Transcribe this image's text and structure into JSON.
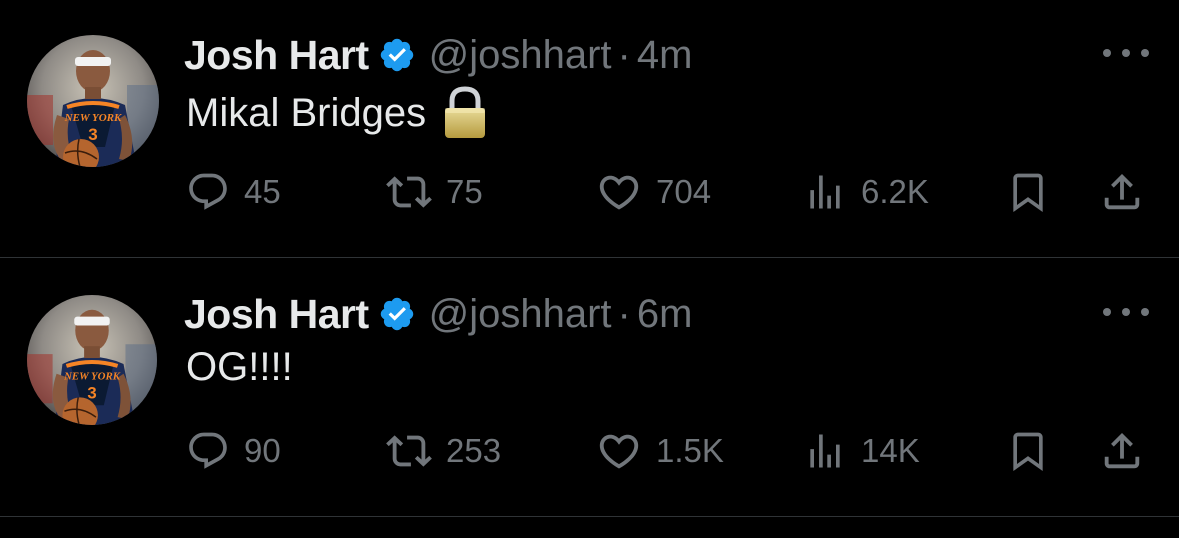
{
  "tweets": [
    {
      "author_name": "Josh Hart",
      "handle": "@joshhart",
      "separator": "·",
      "time": "4m",
      "text": "Mikal Bridges",
      "emoji": "lock-emoji",
      "replies": "45",
      "reposts": "75",
      "likes": "704",
      "views": "6.2K"
    },
    {
      "author_name": "Josh Hart",
      "handle": "@joshhart",
      "separator": "·",
      "time": "6m",
      "text": "OG!!!!",
      "replies": "90",
      "reposts": "253",
      "likes": "1.5K",
      "views": "14K"
    }
  ],
  "jersey": {
    "team_text": "NEW YORK",
    "number": "3"
  },
  "colors": {
    "background": "#000000",
    "primary_text": "#e7e9ea",
    "secondary_text": "#71767b",
    "verified_blue": "#1d9bf0",
    "divider": "#2f3336",
    "knicks_orange": "#f58426",
    "knicks_navy": "#0b1a33"
  },
  "icons": [
    "verified-badge-icon",
    "more-icon",
    "reply-icon",
    "repost-icon",
    "like-icon",
    "views-icon",
    "bookmark-icon",
    "share-icon"
  ]
}
